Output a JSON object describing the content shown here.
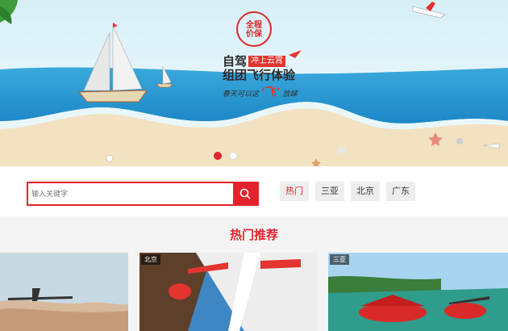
{
  "banner": {
    "stamp_text": "全程\n价保",
    "headline_line1": "自驾",
    "headline_tag": "冲上云霄",
    "headline_line2": "组团飞行体验",
    "subline": "春天可以这",
    "subline_accent": "‘飞’",
    "subline_end": "放肆",
    "dots": [
      {
        "active": true
      },
      {
        "active": false
      }
    ]
  },
  "search": {
    "placeholder": "输入关键字"
  },
  "tags": [
    {
      "label": "热门",
      "active": true
    },
    {
      "label": "三亚",
      "active": false
    },
    {
      "label": "北京",
      "active": false
    },
    {
      "label": "广东",
      "active": false
    }
  ],
  "section": {
    "title": "热门推荐"
  },
  "cards": [
    {
      "label": ""
    },
    {
      "label": "北京"
    },
    {
      "label": "三亚"
    }
  ],
  "colors": {
    "accent": "#e3232c",
    "sky": "#bfe3f3",
    "sea": "#2f9fd6",
    "sand": "#f3e2c2"
  }
}
